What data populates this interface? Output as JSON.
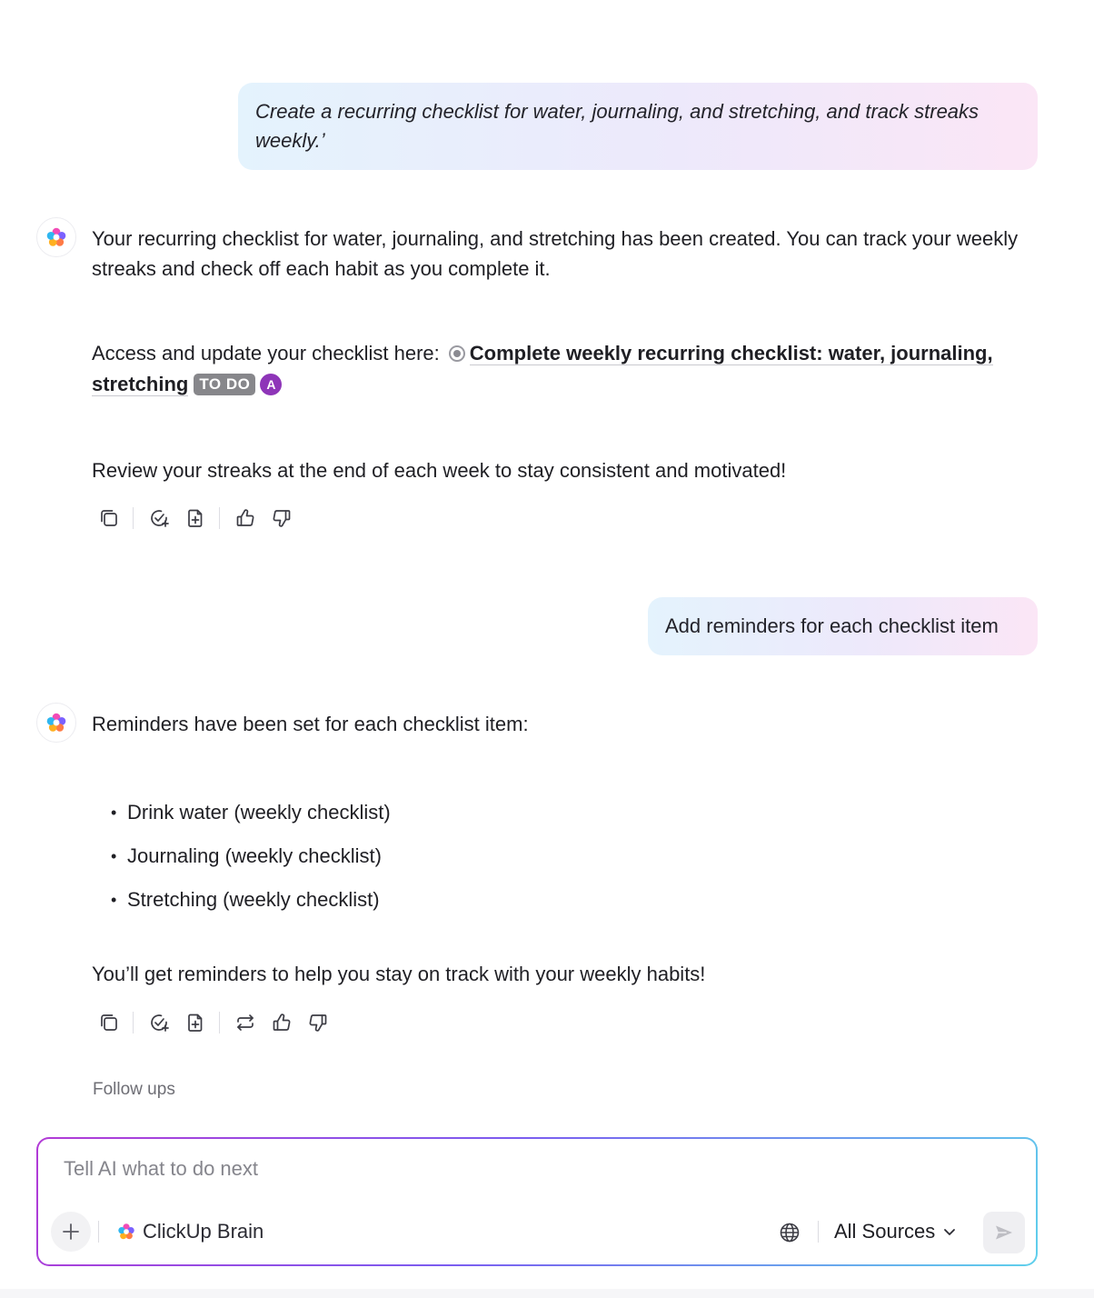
{
  "conversation": {
    "user_message_1": "Create a recurring checklist for water, journaling, and stretching, and track streaks weekly.’",
    "ai_message_1": {
      "intro": "Your recurring checklist for water, journaling, and stretching has been created. You can track your weekly streaks and check off each habit as you complete it.",
      "access_label": "Access and update your checklist here:",
      "task_name": "Complete weekly recurring checklist: water, journaling, stretching",
      "task_status": "TO DO",
      "task_assignee": "A",
      "closing": "Review your streaks at the end of each week to stay consistent and motivated!"
    },
    "user_message_2": "Add reminders for each checklist item",
    "ai_message_2": {
      "intro": "Reminders have been set for each checklist item:",
      "items": [
        "Drink water (weekly checklist)",
        "Journaling (weekly checklist)",
        "Stretching (weekly checklist)"
      ],
      "closing": "You’ll get reminders to help you stay on track with your weekly habits!"
    },
    "follow_ups_label": "Follow ups"
  },
  "composer": {
    "placeholder": "Tell AI what to do next",
    "value": "",
    "model_label": "ClickUp Brain",
    "sources_label": "All Sources"
  },
  "colors": {
    "assignee_bg": "#8e35b8",
    "status_badge_bg": "#87878b",
    "composer_border_start": "#b23ad6",
    "composer_border_end": "#5fd0ec"
  },
  "icons": {
    "ai_avatar": "clickup-brain-logo-icon",
    "actions_1": [
      "copy-icon",
      "create-task-icon",
      "add-to-doc-icon",
      "thumbs-up-icon",
      "thumbs-down-icon"
    ],
    "actions_2": [
      "copy-icon",
      "create-task-icon",
      "add-to-doc-icon",
      "regenerate-icon",
      "thumbs-up-icon",
      "thumbs-down-icon"
    ],
    "composer": [
      "plus-icon",
      "clickup-brain-logo-icon",
      "globe-icon",
      "chevron-down-icon",
      "send-icon"
    ]
  }
}
